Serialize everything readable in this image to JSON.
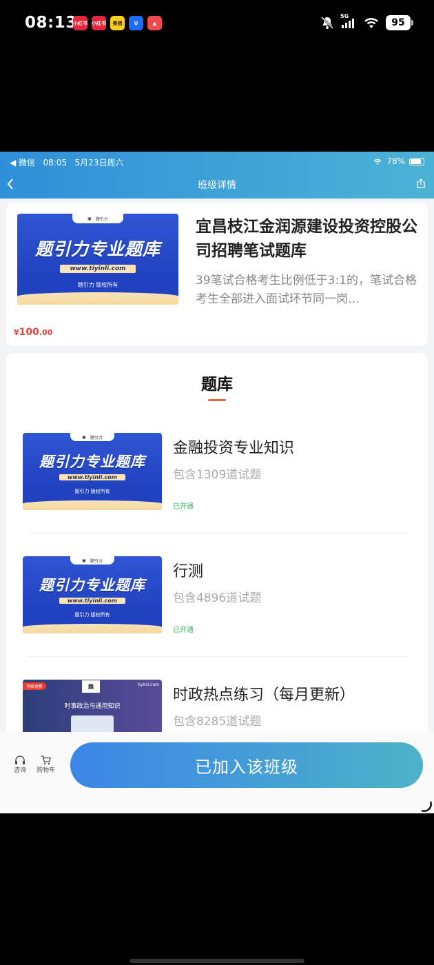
{
  "status_bar": {
    "time": "08:13",
    "apps": [
      {
        "name": "xiaohongshu-app-icon",
        "label": "小红书",
        "color": "#e6263b"
      },
      {
        "name": "xiaohongshu-app-icon-2",
        "label": "小红书",
        "color": "#e6263b"
      },
      {
        "name": "meituan-app-icon",
        "label": "美团",
        "color": "#ffcf1a"
      },
      {
        "name": "uu-app-icon",
        "label": "U",
        "color": "#1e6df6"
      },
      {
        "name": "triangle-app-icon",
        "label": "▲",
        "color": "#f04a4a"
      }
    ],
    "network": "5G",
    "battery": "95"
  },
  "inner_status": {
    "back_app": "◀ 微信",
    "time": "08:05",
    "date": "5月23日周六",
    "battery": "78%"
  },
  "nav": {
    "title": "班级详情"
  },
  "course": {
    "title": "宜昌枝江金润源建设投资控股公司招聘笔试题库",
    "description": "39笔试合格考生比例低于3:1的，笔试合格考生全部进入面试环节同一岗…",
    "price_symbol": "¥",
    "price_int": "100",
    "price_dec": ".00"
  },
  "thumb": {
    "tag": "题引力",
    "headline": "题引力专业题库",
    "url": "www.tiyinli.com",
    "copyright": "题引力 版权所有"
  },
  "thumb_alt": {
    "badge": "持续更新",
    "site": "tiyinli.com",
    "headline": "时事政治与通用知识"
  },
  "bank": {
    "section_title": "题库",
    "items": [
      {
        "title": "金融投资专业知识",
        "count": "包含1309道试题",
        "status": "已开通"
      },
      {
        "title": "行测",
        "count": "包含4896道试题",
        "status": "已开通"
      },
      {
        "title": "时政热点练习（每月更新）",
        "count": "包含8285道试题",
        "status": ""
      }
    ]
  },
  "bottom_bar": {
    "consult_label": "咨询",
    "cart_label": "购物车",
    "join_label": "已加入该班级"
  }
}
